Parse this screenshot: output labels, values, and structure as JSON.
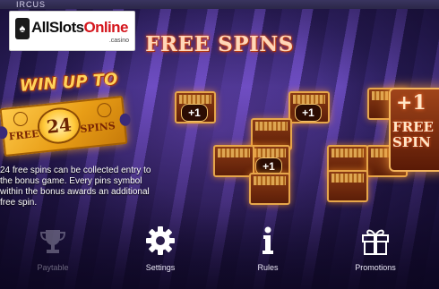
{
  "game": {
    "name": "IRCUS"
  },
  "logo": {
    "text_prefix": "AllSlots",
    "text_accent": "Online",
    "sub": ".casino"
  },
  "screen_title": "FREE SPINS",
  "promo": {
    "headline": "WIN UP TO",
    "ticket_count": "24",
    "ticket_left": "FREE",
    "ticket_right": "SPINS"
  },
  "description": "24 free spins can be collected entry to the bonus game. Every pins symbol within the bonus awards an additional free spin.",
  "symbols": {
    "badge": "+1",
    "big": {
      "plus": "+1",
      "line1": "FREE",
      "line2": "SPIN"
    }
  },
  "nav": [
    {
      "label": "Paytable",
      "icon": "trophy-icon",
      "active": false
    },
    {
      "label": "Settings",
      "icon": "gear-icon",
      "active": true
    },
    {
      "label": "Rules",
      "icon": "info-icon",
      "active": true
    },
    {
      "label": "Promotions",
      "icon": "gift-icon",
      "active": true
    }
  ],
  "colors": {
    "title_glow": "#ff6a2a",
    "ticket_gold": "#ffcc4d",
    "tile_border": "#e6a64a"
  }
}
